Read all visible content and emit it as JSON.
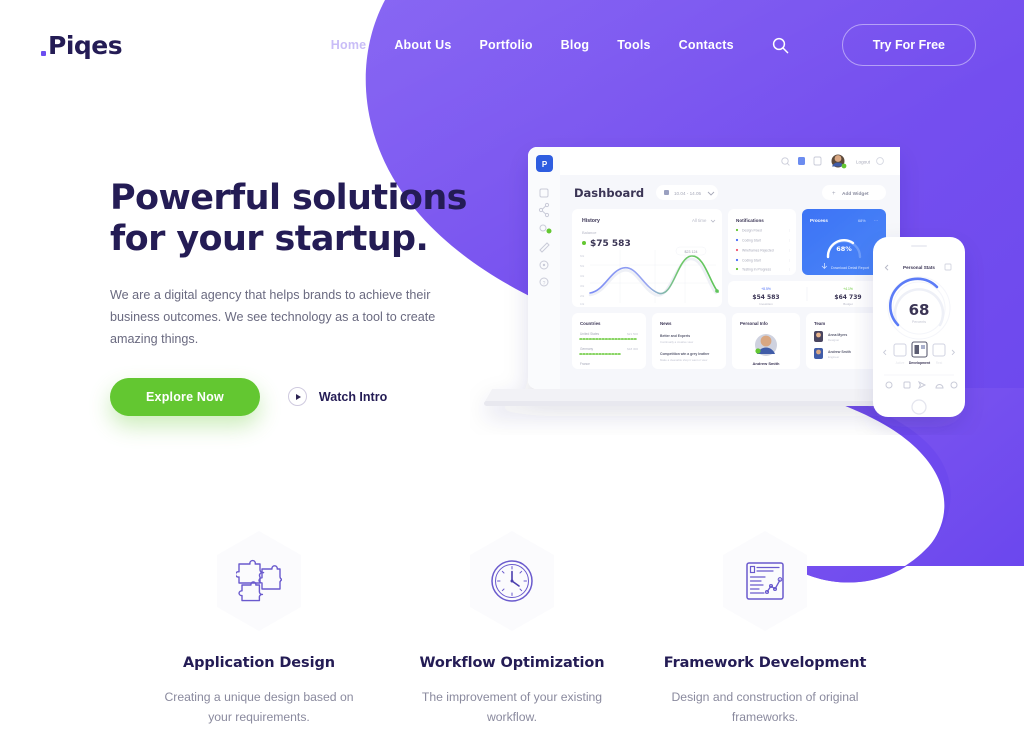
{
  "brand": {
    "name": "Piqes"
  },
  "nav": {
    "items": [
      {
        "label": "Home",
        "active": true
      },
      {
        "label": "About Us",
        "active": false
      },
      {
        "label": "Portfolio",
        "active": false
      },
      {
        "label": "Blog",
        "active": false
      },
      {
        "label": "Tools",
        "active": false
      },
      {
        "label": "Contacts",
        "active": false
      }
    ],
    "search_icon": "search-icon",
    "cta_label": "Try For Free"
  },
  "hero": {
    "title_line1": "Powerful solutions",
    "title_line2": "for your startup.",
    "paragraph": "We are a digital agency that helps brands to achieve their business outcomes. We see technology as a tool to create amazing things.",
    "primary_button": "Explore Now",
    "secondary_button": "Watch Intro",
    "play_icon": "play-icon"
  },
  "device_mockup": {
    "laptop": {
      "app_logo": "P",
      "page_title": "Dashboard",
      "date_filter": "10.04 - 14.05",
      "add_widget": "Add Widget",
      "logout": "Logout",
      "history_card": {
        "title": "History",
        "range_label": "All time",
        "balance_label": "Balance",
        "balance_value": "$75 583",
        "tooltip": "$23 124"
      },
      "notifications_card": {
        "title": "Notifications",
        "items": [
          "Design Fixed",
          "Coding Start",
          "Wireframes Rejected",
          "Coding Start",
          "Testing In Progress"
        ]
      },
      "progress_card": {
        "title": "Process",
        "percent_label": "68%",
        "gauge_value": "68%",
        "footer": "Download Detail Report"
      },
      "stats": [
        {
          "delta": "+8.5%",
          "value": "$54 583",
          "label": "Investition"
        },
        {
          "delta": "+4.1%",
          "value": "$64 739",
          "label": "Budget"
        }
      ],
      "bottom_cards": [
        {
          "title": "Countries",
          "rows": [
            {
              "name": "United States",
              "value": "$21 500"
            },
            {
              "name": "Germany",
              "value": "$18 300"
            },
            {
              "name": "France",
              "value": "$12 100"
            }
          ]
        },
        {
          "title": "News",
          "rows": [
            {
              "name": "Better and Experts",
              "value": "Continually a creative view"
            },
            {
              "name": "Competition win a grey leather",
              "value": "Make a cleanable shop it want or view"
            }
          ]
        },
        {
          "title": "Personal Info",
          "person": "Andrew Smith"
        },
        {
          "title": "Team",
          "members": [
            {
              "name": "Anna Myers",
              "role": "Designer"
            },
            {
              "name": "Andrew Smith",
              "role": "Engineer"
            }
          ]
        }
      ]
    },
    "phone": {
      "screen_title": "Personal Stats",
      "gauge_value": "68",
      "gauge_unit": "Percents",
      "tabs": [
        "Active",
        "Development",
        "Rest"
      ]
    }
  },
  "features": [
    {
      "icon": "puzzle-icon",
      "title": "Application Design",
      "text": "Creating a unique design based on your requirements."
    },
    {
      "icon": "clock-icon",
      "title": "Workflow Optimization",
      "text": "The improvement of your existing workflow."
    },
    {
      "icon": "document-chart-icon",
      "title": "Framework Development",
      "text": "Design and construction of original frameworks."
    }
  ],
  "colors": {
    "purple": "#7650ef",
    "purple_light": "#8a63f4",
    "green": "#63c731",
    "dark": "#241c55",
    "blue": "#4a6cf7"
  }
}
